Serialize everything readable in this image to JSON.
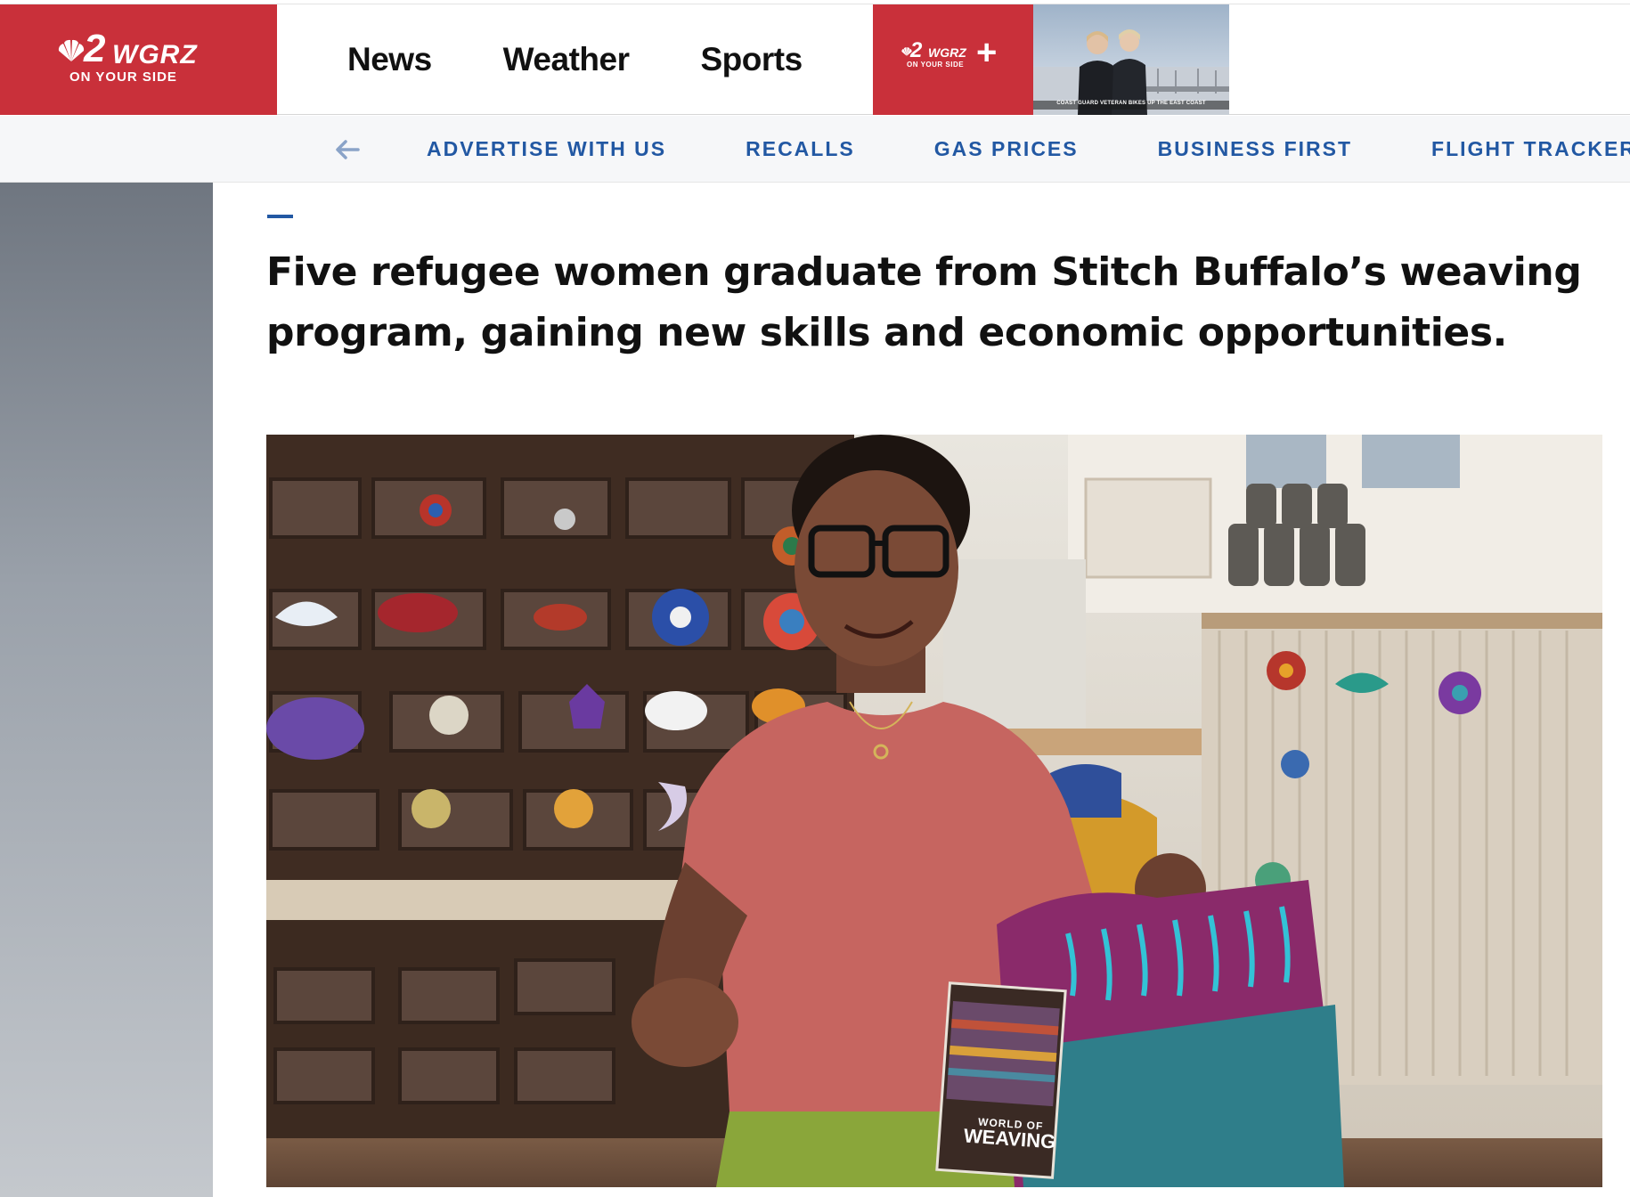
{
  "header": {
    "logo": {
      "channel": "2",
      "call_letters": "WGRZ",
      "tagline": "ON YOUR SIDE",
      "icon": "nbc-peacock-icon"
    },
    "nav": [
      {
        "label": "News"
      },
      {
        "label": "Weather"
      },
      {
        "label": "Sports"
      }
    ],
    "plus": {
      "channel": "2",
      "call_letters": "WGRZ",
      "tagline": "ON YOUR SIDE",
      "sign": "+"
    },
    "promo": {
      "caption": "COAST GUARD VETERAN BIKES UP THE EAST COAST"
    },
    "brand_color": "#c9303a"
  },
  "subnav": {
    "back_icon": "arrow-left-icon",
    "items": [
      {
        "label": "ADVERTISE WITH US"
      },
      {
        "label": "RECALLS"
      },
      {
        "label": "GAS PRICES"
      },
      {
        "label": "BUSINESS FIRST"
      },
      {
        "label": "FLIGHT TRACKER"
      }
    ],
    "link_color": "#2258a3"
  },
  "article": {
    "headline": "Five refugee women graduate from Stitch Buffalo’s weaving program, gaining new skills and economic opportunities.",
    "hero_image": {
      "tag_text_line1": "WORLD OF",
      "tag_text_line2": "WEAVING"
    }
  }
}
